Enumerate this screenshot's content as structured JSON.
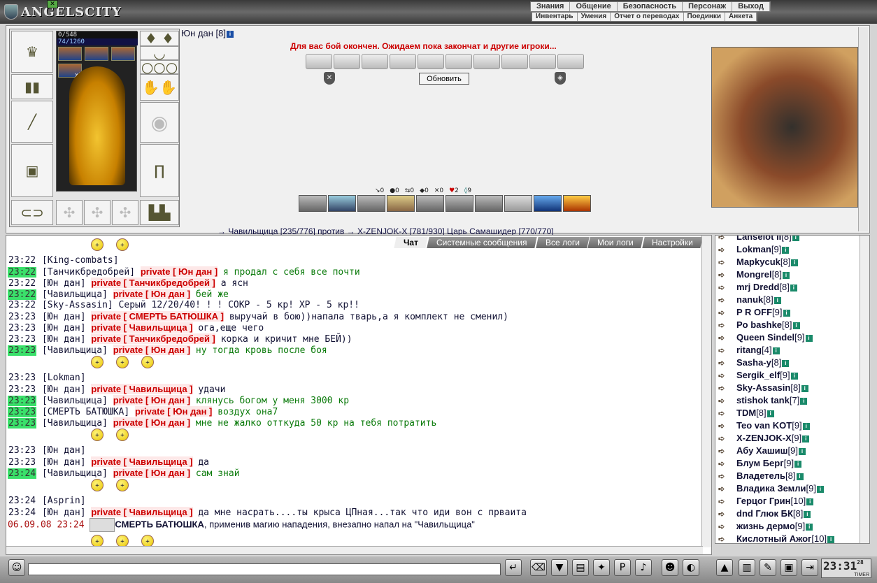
{
  "app": {
    "logo": "ANGELSCITY"
  },
  "nav": {
    "primary": [
      "Знания",
      "Общение",
      "Безопасность",
      "Персонаж",
      "Выход"
    ],
    "secondary": [
      "Инвентарь",
      "Умения",
      "Отчет о переводах",
      "Поединки",
      "Анкета"
    ]
  },
  "character": {
    "name": "Юн дан",
    "level": "[8]",
    "hp": "0/548",
    "mp": "74/1260",
    "buff_count": "x3"
  },
  "battle": {
    "message": "Для вас бой окончен. Ожидаем пока закончат и другие игроки...",
    "refresh_label": "Обновить",
    "stats": [
      "0",
      "0",
      "0",
      "0",
      "0",
      "2",
      "9"
    ],
    "opponents": "→ Чавильщица [235/776] против → X-ZENJOK-X [781/930] Царь Самашидер [770/770]"
  },
  "tabs": [
    "Чат",
    "Системные сообщения",
    "Все логи",
    "Мои логи",
    "Настройки"
  ],
  "chat": [
    {
      "time": "23:22",
      "hl": false,
      "user": "King-combats",
      "priv": "",
      "text": ""
    },
    {
      "time": "23:22",
      "hl": true,
      "user": "Танчикбредобрей",
      "priv": "private [ Юн дан ]",
      "text": "я продал с себя все почти"
    },
    {
      "time": "23:22",
      "hl": false,
      "user": "Юн дан",
      "priv": "private [ Танчикбредобрей ]",
      "text": "а ясн"
    },
    {
      "time": "23:22",
      "hl": true,
      "user": "Чавильщица",
      "priv": "private [ Юн дан ]",
      "text": "бей же"
    },
    {
      "time": "23:22",
      "hl": false,
      "user": "Sky-Assasin",
      "priv": "",
      "text": "Серый 12/20/40! ! ! СОКР - 5 кр! ХР - 5 кр!!"
    },
    {
      "time": "23:23",
      "hl": false,
      "user": "Юн дан",
      "priv": "private [ СМЕРТЬ БАТЮШКА ]",
      "text": "выручай в бою))напала тварь,а я комплект не сменил)"
    },
    {
      "time": "23:23",
      "hl": false,
      "user": "Юн дан",
      "priv": "private [ Чавильщица ]",
      "text": "ога,еще чего"
    },
    {
      "time": "23:23",
      "hl": false,
      "user": "Юн дан",
      "priv": "private [ Танчикбредобрей ]",
      "text": "корка и кричит мне БЕЙ))"
    },
    {
      "time": "23:23",
      "hl": true,
      "user": "Чавильщица",
      "priv": "private [ Юн дан ]",
      "text": "ну тогда кровь после боя"
    },
    {
      "time": "23:23",
      "hl": false,
      "user": "Lokman",
      "priv": "",
      "text": ""
    },
    {
      "time": "23:23",
      "hl": false,
      "user": "Юн дан",
      "priv": "private [ Чавильщица ]",
      "text": "удачи"
    },
    {
      "time": "23:23",
      "hl": true,
      "user": "Чавильщица",
      "priv": "private [ Юн дан ]",
      "text": "клянусь богом у меня 3000 кр"
    },
    {
      "time": "23:23",
      "hl": true,
      "user": "СМЕРТЬ БАТЮШКА",
      "priv": "private [ Юн дан ]",
      "text": "воздух она7"
    },
    {
      "time": "23:23",
      "hl": true,
      "user": "Чавильщица",
      "priv": "private [ Юн дан ]",
      "text": "мне не жалко отткуда 50 кр на тебя потратить"
    },
    {
      "time": "23:23",
      "hl": false,
      "user": "Юн дан",
      "priv": "",
      "text": ""
    },
    {
      "time": "23:23",
      "hl": false,
      "user": "Юн дан",
      "priv": "private [ Чавильщица ]",
      "text": "да"
    },
    {
      "time": "23:24",
      "hl": true,
      "user": "Чавильщица",
      "priv": "private [ Юн дан ]",
      "text": "сам знай"
    },
    {
      "time": "23:24",
      "hl": false,
      "user": "Asprin",
      "priv": "",
      "text": ""
    },
    {
      "time": "23:24",
      "hl": false,
      "user": "Юн дан",
      "priv": "private [ Чавильщица ]",
      "text": "да мне насрать....ты крыса ЦПная...так что иди вон с прваита"
    }
  ],
  "system_message": {
    "date": "06.09.08 23:24",
    "actor": "СМЕРТЬ БАТЮШКА",
    "text": ", применив магию нападения, внезапно напал на \"Чавильщица\""
  },
  "users": [
    {
      "name": "Lanselot II",
      "lvl": "[8]"
    },
    {
      "name": "Lokman",
      "lvl": "[9]"
    },
    {
      "name": "Mapkycuk",
      "lvl": "[8]"
    },
    {
      "name": "Mongrel",
      "lvl": "[8]"
    },
    {
      "name": "mrj Dredd",
      "lvl": "[8]"
    },
    {
      "name": "nanuk",
      "lvl": "[8]"
    },
    {
      "name": "P R OFF",
      "lvl": "[9]"
    },
    {
      "name": "Po bashke",
      "lvl": "[8]"
    },
    {
      "name": "Queen Sindel",
      "lvl": "[9]"
    },
    {
      "name": "ritang",
      "lvl": "[4]"
    },
    {
      "name": "Sasha-y",
      "lvl": "[8]"
    },
    {
      "name": "Sergik_elf",
      "lvl": "[9]"
    },
    {
      "name": "Sky-Assasin",
      "lvl": "[8]"
    },
    {
      "name": "stishok tank",
      "lvl": "[7]"
    },
    {
      "name": "TDM",
      "lvl": "[8]"
    },
    {
      "name": "Teo van KOT",
      "lvl": "[9]"
    },
    {
      "name": "X-ZENJOK-X",
      "lvl": "[9]"
    },
    {
      "name": "Абу Хашиш",
      "lvl": "[9]"
    },
    {
      "name": "Блум Берг",
      "lvl": "[9]"
    },
    {
      "name": "Владетель",
      "lvl": "[8]"
    },
    {
      "name": "Владика Земли",
      "lvl": "[9]"
    },
    {
      "name": "Герцог Грин",
      "lvl": "[10]"
    },
    {
      "name": "dnd Глюк БК",
      "lvl": "[8]"
    },
    {
      "name": "жизнь дермо",
      "lvl": "[9]"
    },
    {
      "name": "Кислотный Ажог",
      "lvl": "[10]"
    }
  ],
  "clock": {
    "time": "23:31",
    "seconds": "28",
    "label": "TIMER"
  },
  "colors": {
    "private": "#cc0000",
    "highlight": "#3ae06a",
    "battle_message": "#cc0000"
  }
}
